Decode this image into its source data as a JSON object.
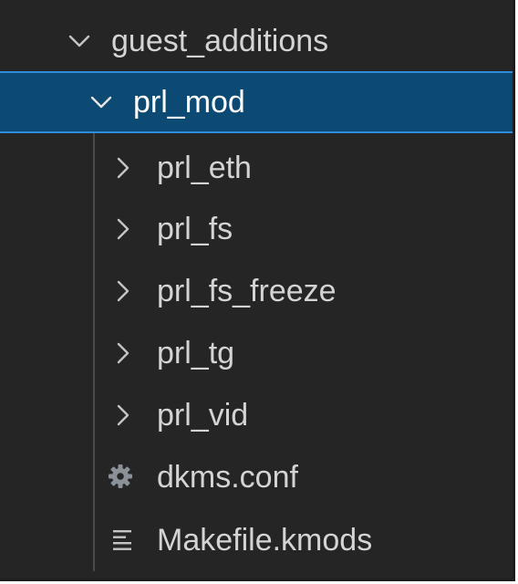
{
  "tree": {
    "root": {
      "label": "guest_additions",
      "expanded": true,
      "icon": "chevron-down-icon"
    },
    "selected": {
      "label": "prl_mod",
      "expanded": true,
      "icon": "chevron-down-icon"
    },
    "children": [
      {
        "label": "prl_eth",
        "type": "folder",
        "icon": "chevron-right-icon"
      },
      {
        "label": "prl_fs",
        "type": "folder",
        "icon": "chevron-right-icon"
      },
      {
        "label": "prl_fs_freeze",
        "type": "folder",
        "icon": "chevron-right-icon"
      },
      {
        "label": "prl_tg",
        "type": "folder",
        "icon": "chevron-right-icon"
      },
      {
        "label": "prl_vid",
        "type": "folder",
        "icon": "chevron-right-icon"
      },
      {
        "label": "dkms.conf",
        "type": "file",
        "icon": "gear-icon"
      },
      {
        "label": "Makefile.kmods",
        "type": "file",
        "icon": "lines-icon"
      }
    ]
  },
  "colors": {
    "background": "#252526",
    "selection": "#0d4a73",
    "selection_border": "#2f8ddb",
    "text": "#d4d4d4",
    "icon": "#c5c5c5"
  }
}
